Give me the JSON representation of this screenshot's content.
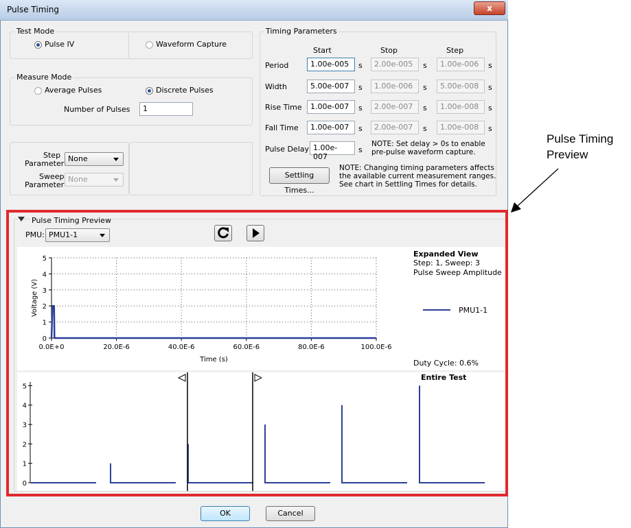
{
  "window": {
    "title": "Pulse Timing",
    "close_label": "x"
  },
  "test_mode": {
    "label": "Test Mode",
    "options": [
      {
        "label": "Pulse IV",
        "selected": true
      },
      {
        "label": "Waveform Capture",
        "selected": false
      }
    ]
  },
  "measure_mode": {
    "label": "Measure Mode",
    "options": [
      {
        "label": "Average Pulses",
        "selected": false
      },
      {
        "label": "Discrete Pulses",
        "selected": true
      }
    ],
    "num_pulses_label": "Number of Pulses",
    "num_pulses_value": "1"
  },
  "params": {
    "step_label_1": "Step",
    "step_label_2": "Parameter",
    "step_value": "None",
    "sweep_label_1": "Sweep",
    "sweep_label_2": "Parameter",
    "sweep_value": "None"
  },
  "timing": {
    "label": "Timing Parameters",
    "headers": [
      "Start",
      "Stop",
      "Step"
    ],
    "unit": "s",
    "rows": [
      {
        "label": "Period",
        "start": "1.00e-005",
        "stop": "2.00e-005",
        "step": "1.00e-006"
      },
      {
        "label": "Width",
        "start": "5.00e-007",
        "stop": "1.00e-006",
        "step": "5.00e-008"
      },
      {
        "label": "Rise Time",
        "start": "1.00e-007",
        "stop": "2.00e-007",
        "step": "1.00e-008"
      },
      {
        "label": "Fall Time",
        "start": "1.00e-007",
        "stop": "2.00e-007",
        "step": "1.00e-008"
      }
    ],
    "pulse_delay_label": "Pulse Delay",
    "pulse_delay_value": "1.00e-007",
    "delay_note_1": "NOTE: Set delay > 0s to enable",
    "delay_note_2": "pre-pulse waveform capture.",
    "settling_button": "Settling Times...",
    "settling_note_1": "NOTE: Changing timing parameters affects",
    "settling_note_2": "the available current measurement ranges.",
    "settling_note_3": "See chart in Settling Times for details."
  },
  "preview": {
    "label": "Pulse Timing Preview",
    "pmu_label": "PMU:",
    "pmu_value": "PMU1-1",
    "refresh_icon": "refresh-icon",
    "play_icon": "play-icon",
    "expanded_title": "Expanded View",
    "expanded_sub1": "Step: 1, Sweep: 3",
    "expanded_sub2": "Pulse Sweep Amplitude",
    "legend_name": "PMU1-1",
    "duty_cycle": "Duty Cycle: 0.6%",
    "entire_title": "Entire Test"
  },
  "footer": {
    "ok_label": "OK",
    "cancel_label": "Cancel"
  },
  "callout": {
    "line1": "Pulse Timing",
    "line2": "Preview"
  },
  "colors": {
    "series": "#2a3f99",
    "highlight": "#e0292d"
  },
  "chart_data": [
    {
      "type": "line",
      "name": "Expanded View",
      "xlabel": "Time (s)",
      "ylabel": "Voltage (V)",
      "xlim": [
        0,
        0.0001
      ],
      "ylim": [
        0,
        5
      ],
      "x_tick_labels": [
        "0.0E+0",
        "20.0E-6",
        "40.0E-6",
        "60.0E-6",
        "80.0E-6",
        "100.0E-6"
      ],
      "x_ticks": [
        0,
        2e-05,
        4e-05,
        6e-05,
        8e-05,
        0.0001
      ],
      "y_ticks": [
        0,
        1,
        2,
        3,
        4,
        5
      ],
      "grid": true,
      "legend": "right",
      "series": [
        {
          "name": "PMU1-1",
          "x": [
            0,
            1e-07,
            6e-07,
            7e-07,
            0.0001
          ],
          "y": [
            0,
            2,
            2,
            0,
            0
          ]
        }
      ]
    },
    {
      "type": "line",
      "name": "Entire Test",
      "ylim": [
        0,
        5
      ],
      "y_ticks": [
        0,
        1,
        2,
        3,
        4,
        5
      ],
      "pulse_amplitudes": [
        0,
        1,
        2,
        3,
        4,
        5
      ]
    }
  ]
}
